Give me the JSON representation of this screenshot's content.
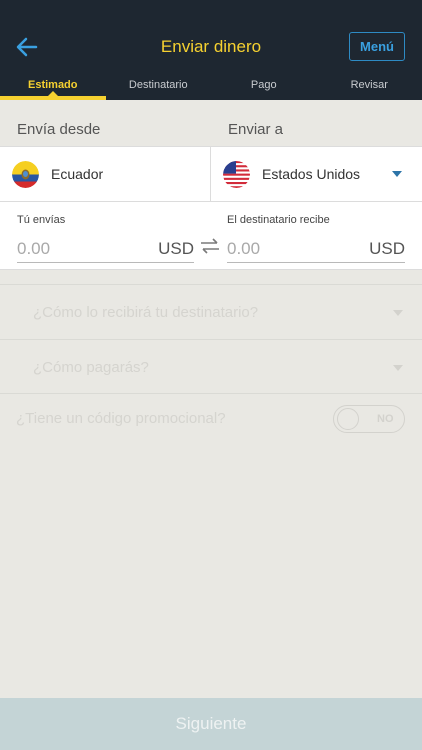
{
  "header": {
    "title": "Enviar dinero",
    "menu_label": "Menú",
    "tabs": [
      {
        "label": "Estimado",
        "active": true
      },
      {
        "label": "Destinatario",
        "active": false
      },
      {
        "label": "Pago",
        "active": false
      },
      {
        "label": "Revisar",
        "active": false
      }
    ]
  },
  "countries": {
    "from_label": "Envía desde",
    "to_label": "Enviar a",
    "from_country": "Ecuador",
    "to_country": "Estados Unidos"
  },
  "amounts": {
    "send_label": "Tú envías",
    "send_value": "0.00",
    "send_currency": "USD",
    "receive_label": "El destinatario recibe",
    "receive_value": "0.00",
    "receive_currency": "USD"
  },
  "options": {
    "delivery_placeholder": "¿Cómo lo recibirá tu destinatario?",
    "payment_placeholder": "¿Cómo pagarás?",
    "promo_label": "¿Tiene un código promocional?",
    "promo_toggle": "NO"
  },
  "footer": {
    "next_label": "Siguiente"
  },
  "colors": {
    "header_bg": "#1e2731",
    "accent_yellow": "#f6d130",
    "accent_blue": "#2e8bc4"
  }
}
